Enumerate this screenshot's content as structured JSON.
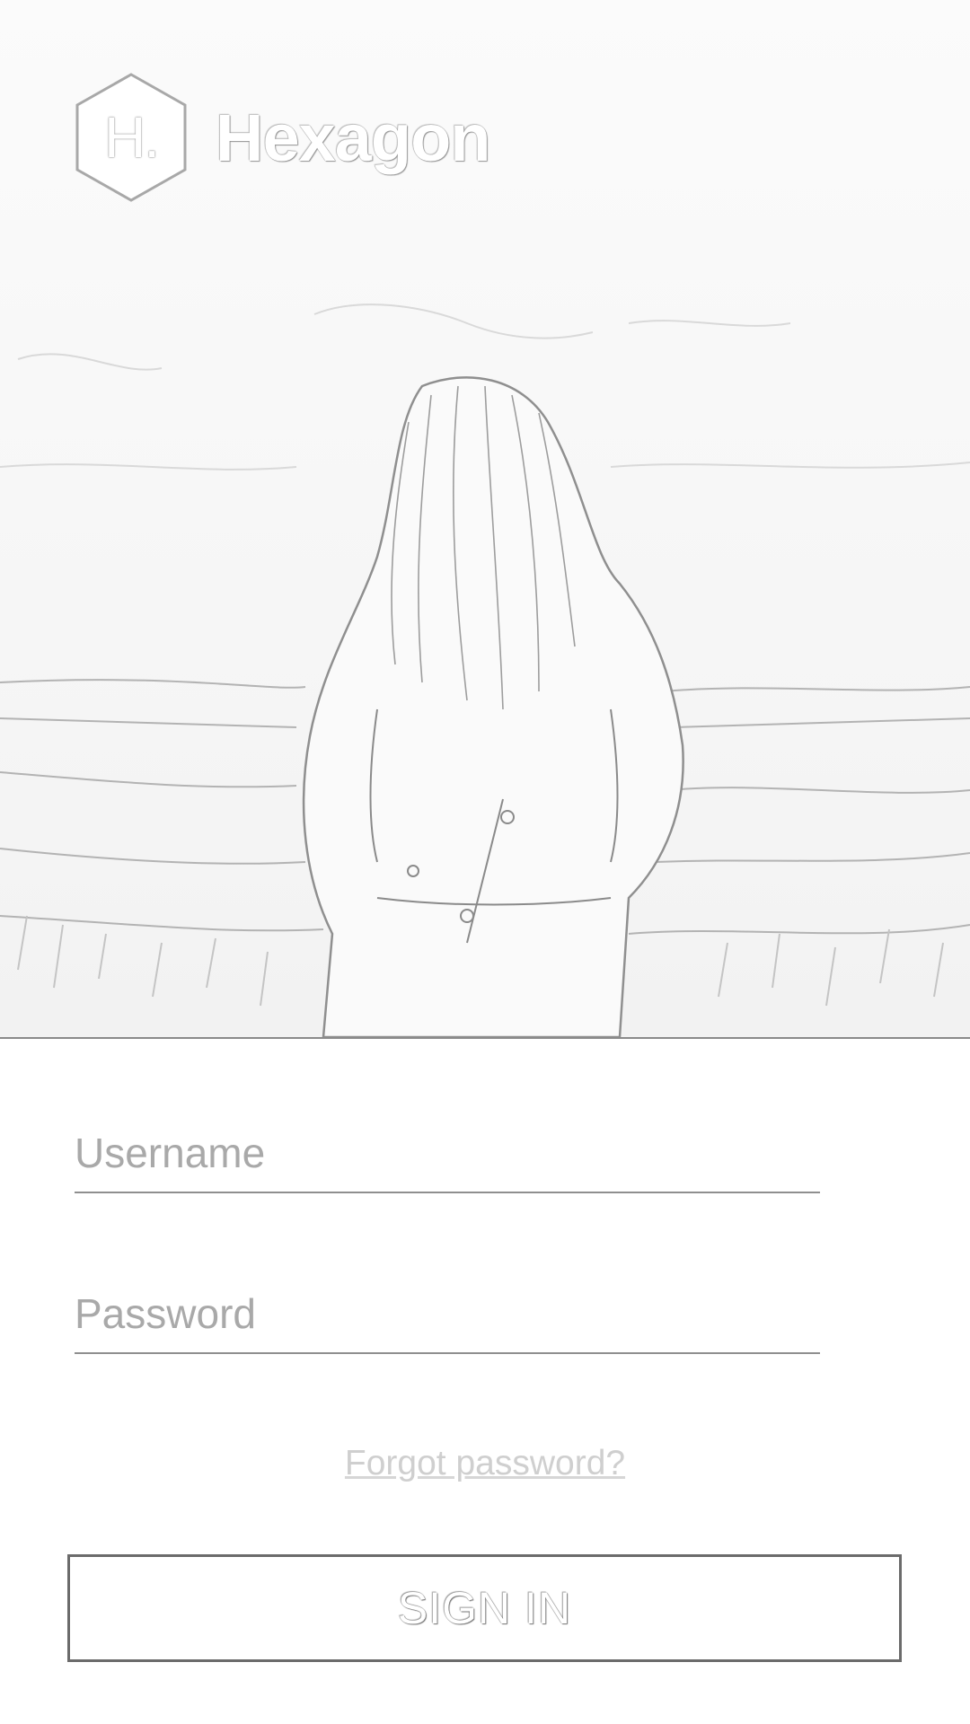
{
  "brand": {
    "logo_letter": "H.",
    "name": "Hexagon"
  },
  "hero": {
    "image_icon": "photo-person-facing-landscape"
  },
  "form": {
    "username_placeholder": "Username",
    "password_placeholder": "Password",
    "username_value": "",
    "password_value": ""
  },
  "links": {
    "forgot_password": "Forgot password?"
  },
  "actions": {
    "sign_in": "SIGN IN"
  }
}
